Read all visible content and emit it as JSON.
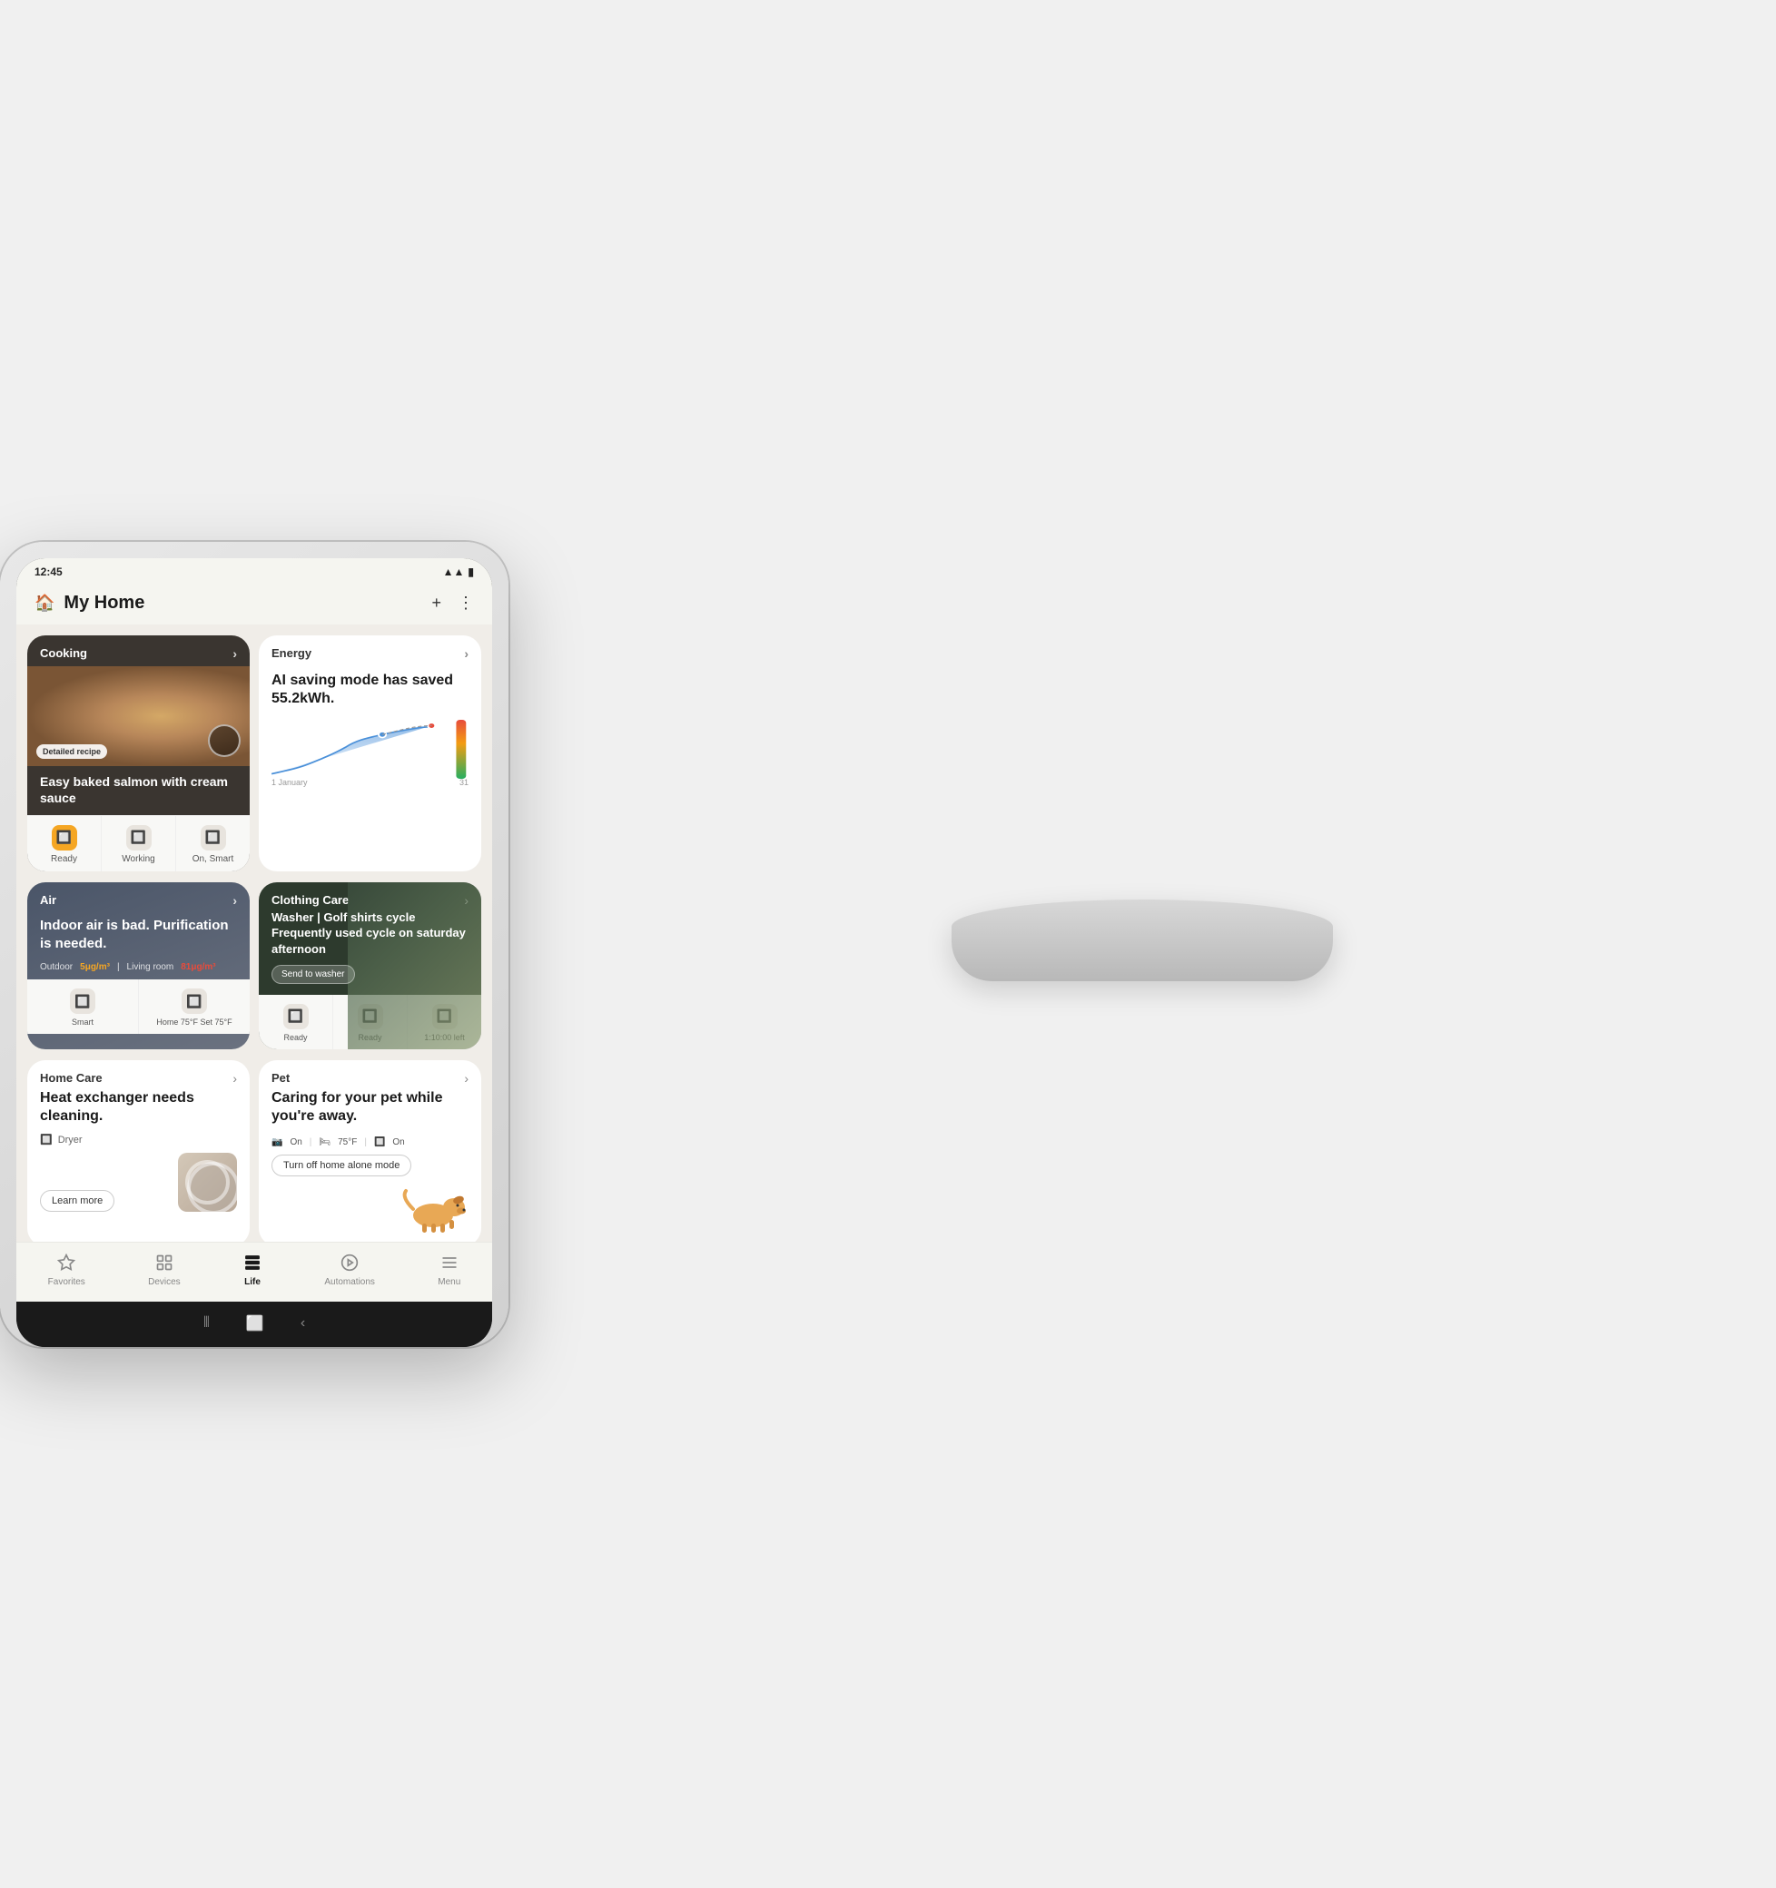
{
  "status_bar": {
    "time": "12:45",
    "signal_icon": "signal-icon",
    "battery_icon": "battery-icon"
  },
  "header": {
    "home_icon": "home-icon",
    "title": "My Home",
    "add_icon": "add-icon",
    "menu_icon": "more-menu-icon"
  },
  "cooking_card": {
    "category": "Cooking",
    "title": "Easy baked salmon with cream sauce",
    "recipe_badge": "Detailed recipe",
    "chevron": "chevron-right-icon",
    "devices": [
      {
        "label": "Ready",
        "icon": "oven-icon",
        "highlight": true
      },
      {
        "label": "Working",
        "icon": "microwave-icon",
        "highlight": false
      },
      {
        "label": "On, Smart",
        "icon": "hood-icon",
        "highlight": false
      }
    ]
  },
  "energy_card": {
    "category": "Energy",
    "description": "AI saving mode has saved 55.2kWh.",
    "date_start": "1 January",
    "date_end": "31",
    "chevron": "chevron-right-icon"
  },
  "air_card": {
    "category": "Air",
    "title": "Indoor air is bad. Purification is needed.",
    "outdoor_label": "Outdoor",
    "outdoor_value": "5μg/m³",
    "living_room_label": "Living room",
    "living_room_value": "81μg/m³",
    "chevron": "chevron-right-icon",
    "devices": [
      {
        "label": "Smart",
        "icon": "air-purifier-icon"
      },
      {
        "label": "Home 75°F Set 75°F",
        "icon": "thermostat-icon"
      }
    ]
  },
  "clothing_card": {
    "category": "Clothing Care",
    "title": "Washer | Golf shirts cycle Frequently used cycle on saturday afternoon",
    "send_button": "Send to washer",
    "chevron": "chevron-right-icon",
    "devices": [
      {
        "label": "Ready",
        "icon": "washer-icon"
      },
      {
        "label": "Ready",
        "icon": "dryer-small-icon"
      },
      {
        "label": "1:10:00 left",
        "icon": "wash-tower-icon"
      }
    ]
  },
  "home_care_card": {
    "category": "Home Care",
    "title": "Heat exchanger needs cleaning.",
    "device_label": "Dryer",
    "device_icon": "dryer-icon",
    "learn_more": "Learn more",
    "chevron": "chevron-right-icon"
  },
  "pet_card": {
    "category": "Pet",
    "title": "Caring for your pet while you're away.",
    "status_on1": "On",
    "status_temp": "75°F",
    "status_on2": "On",
    "button": "Turn off home alone mode",
    "chevron": "chevron-right-icon"
  },
  "bottom_nav": {
    "items": [
      {
        "label": "Favorites",
        "icon": "star-icon",
        "active": false
      },
      {
        "label": "Devices",
        "icon": "devices-icon",
        "active": false
      },
      {
        "label": "Life",
        "icon": "life-icon",
        "active": true
      },
      {
        "label": "Automations",
        "icon": "automations-icon",
        "active": false
      },
      {
        "label": "Menu",
        "icon": "menu-icon",
        "active": false
      }
    ]
  },
  "gesture_bar": {
    "back_icon": "back-icon",
    "home_gesture_icon": "home-gesture-icon",
    "recents_icon": "recents-icon"
  }
}
